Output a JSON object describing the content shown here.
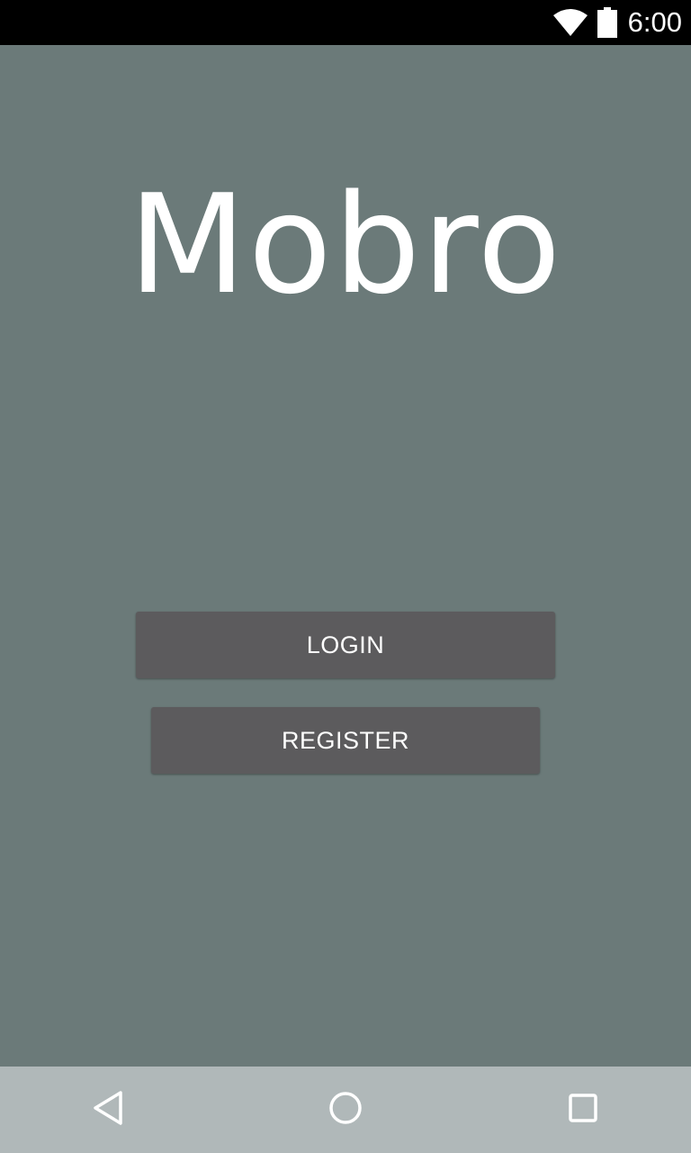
{
  "status_bar": {
    "time": "6:00",
    "wifi_icon": "wifi-icon",
    "battery_icon": "battery-icon"
  },
  "app": {
    "title": "Mobro"
  },
  "buttons": {
    "login_label": "LOGIN",
    "register_label": "REGISTER"
  },
  "nav_bar": {
    "back_icon": "back-triangle-icon",
    "home_icon": "home-circle-icon",
    "recents_icon": "recents-square-icon"
  },
  "colors": {
    "background": "#6b7a79",
    "button": "#5c5b5d",
    "status_bar": "#000000",
    "nav_bar": "#b0b8b9",
    "text": "#ffffff"
  }
}
